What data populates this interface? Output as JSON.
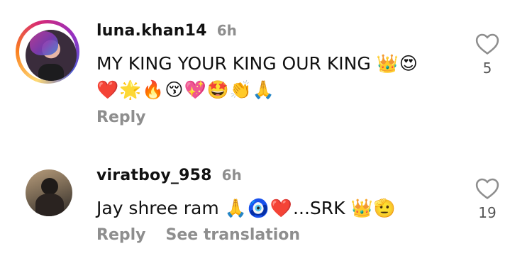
{
  "comments": [
    {
      "username": "luna.khan14",
      "time": "6h",
      "text_line1": "MY KING YOUR KING OUR KING",
      "text_line1_emoji": "👑😍",
      "text_line2_emoji": "❤️🌟🔥😚💖🤩👏🙏",
      "like_count": "5",
      "actions": {
        "reply": "Reply"
      },
      "avatar_ring": true,
      "icons": {
        "like": "heart-outline-icon"
      }
    },
    {
      "username": "viratboy_958",
      "time": "6h",
      "text": "Jay shree ram",
      "text_emoji_1": "🙏🧿❤️",
      "text_mid": "...SRK",
      "text_emoji_2": "👑🫡",
      "like_count": "19",
      "actions": {
        "reply": "Reply",
        "see_translation": "See translation"
      },
      "avatar_ring": false,
      "icons": {
        "like": "heart-outline-icon"
      }
    }
  ],
  "colors": {
    "text_primary": "#111111",
    "text_secondary": "#8e8e8e",
    "background": "#ffffff"
  }
}
